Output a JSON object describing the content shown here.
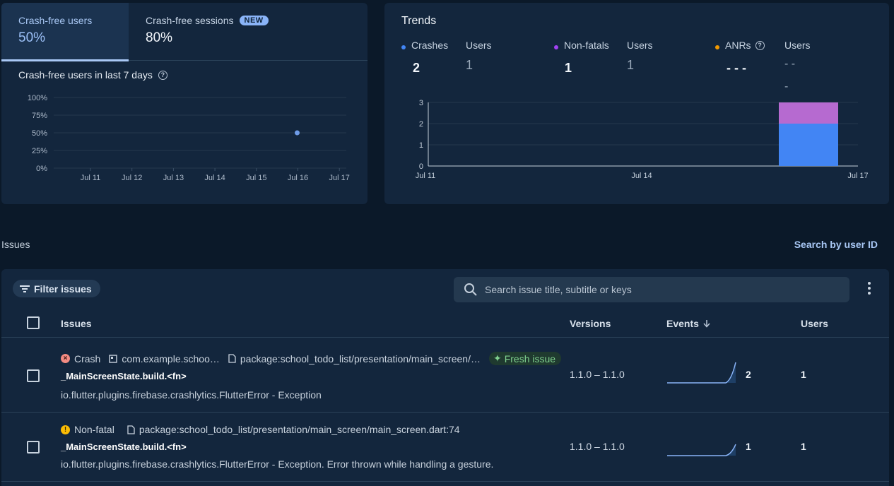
{
  "crash_card": {
    "tabs": [
      {
        "label": "Crash-free users",
        "value": "50%"
      },
      {
        "label": "Crash-free sessions",
        "value": "80%",
        "badge": "NEW"
      }
    ],
    "chart_title": "Crash-free users in last 7 days"
  },
  "trends": {
    "title": "Trends",
    "metrics": [
      {
        "label": "Crashes",
        "value": "2",
        "users_label": "Users",
        "users_value": "1",
        "color": "#4285f4"
      },
      {
        "label": "Non-fatals",
        "value": "1",
        "users_label": "Users",
        "users_value": "1",
        "color": "#a142f4"
      },
      {
        "label": "ANRs",
        "value": "- - -",
        "users_label": "Users",
        "users_value": "- -",
        "users_value2": "-",
        "color": "#f29900"
      }
    ]
  },
  "issues_section": {
    "heading": "Issues",
    "search_by_user": "Search by user ID",
    "filter_label": "Filter issues",
    "search_placeholder": "Search issue title, subtitle or keys",
    "columns": {
      "issues": "Issues",
      "versions": "Versions",
      "events": "Events",
      "users": "Users"
    },
    "rows": [
      {
        "type": "Crash",
        "package": "com.example.schoo…",
        "file": "package:school_todo_list/presentation/main_screen/…",
        "tag": "Fresh issue",
        "title": "_MainScreenState.build.<fn>",
        "subtitle": "io.flutter.plugins.firebase.crashlytics.FlutterError - Exception",
        "versions": "1.1.0 – 1.1.0",
        "events": "2",
        "users": "1"
      },
      {
        "type": "Non-fatal",
        "file": "package:school_todo_list/presentation/main_screen/main_screen.dart:74",
        "title": "_MainScreenState.build.<fn>",
        "subtitle": "io.flutter.plugins.firebase.crashlytics.FlutterError - Exception. Error thrown while handling a gesture.",
        "versions": "1.1.0 – 1.1.0",
        "events": "1",
        "users": "1"
      }
    ]
  },
  "chart_data": [
    {
      "type": "scatter",
      "title": "Crash-free users in last 7 days",
      "x": [
        "Jul 11",
        "Jul 12",
        "Jul 13",
        "Jul 14",
        "Jul 15",
        "Jul 16",
        "Jul 17"
      ],
      "yticks": [
        "100%",
        "75%",
        "50%",
        "25%",
        "0%"
      ],
      "points": [
        {
          "x": "Jul 16",
          "y": 50
        }
      ],
      "ylim": [
        0,
        100
      ],
      "grid": true
    },
    {
      "type": "bar",
      "stacked": true,
      "xticks": [
        "Jul 11",
        "Jul 14",
        "Jul 17"
      ],
      "yticks": [
        "3",
        "2",
        "1",
        "0"
      ],
      "ylim": [
        0,
        3
      ],
      "series": [
        {
          "name": "Crashes",
          "color": "#4285f4",
          "values": [
            {
              "x": "Jul 16",
              "y": 2
            }
          ]
        },
        {
          "name": "Non-fatals",
          "color": "#b66ad0",
          "values": [
            {
              "x": "Jul 16",
              "y": 1
            }
          ]
        }
      ],
      "grid": true
    }
  ]
}
